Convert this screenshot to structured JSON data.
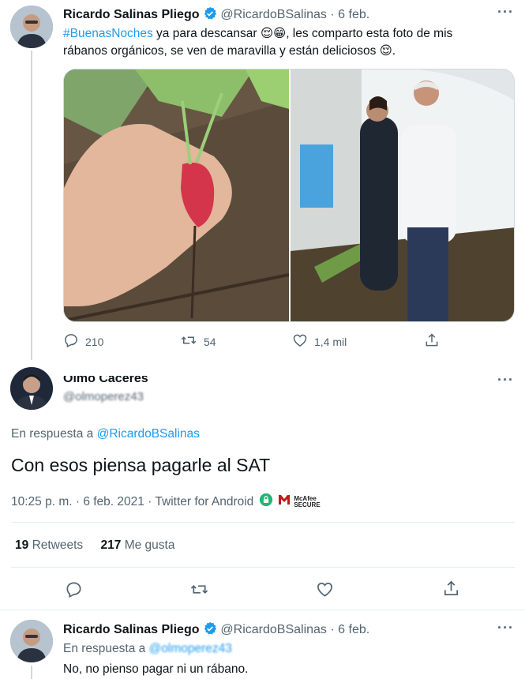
{
  "tweet1": {
    "name": "Ricardo Salinas Pliego",
    "handle": "@RicardoBSalinas",
    "date": "· 6 feb.",
    "hashtag": "#BuenasNoches",
    "text_part1": " ya para descansar 😌😁, les comparto esta foto de mis",
    "text_line2": "rábanos orgánicos, se ven de maravilla y están deliciosos 😌.",
    "replies": "210",
    "retweets": "54",
    "likes": "1,4 mil"
  },
  "tweet2": {
    "name": "Olmo Cáceres",
    "handle": "@olmoperez43",
    "reply_prefix": "En respuesta a ",
    "reply_to": "@RicardoBSalinas",
    "text": "Con esos piensa pagarle al SAT",
    "timestamp": "10:25 p. m. · 6 feb. 2021 · Twitter for Android",
    "mcafee_line1": "McAfee",
    "mcafee_line2": "SECURE",
    "retweets_count": "19",
    "retweets_label": "Retweets",
    "likes_count": "217",
    "likes_label": "Me gusta"
  },
  "tweet3": {
    "name": "Ricardo Salinas Pliego",
    "handle": "@RicardoBSalinas",
    "date": "· 6 feb.",
    "reply_prefix": "En respuesta a ",
    "reply_to": "@olmoperez43",
    "text": "No, no pienso pagar ni un rábano."
  },
  "colors": {
    "accent": "#1d9bf0",
    "text": "#0f1419",
    "muted": "#536471",
    "verified": "#1d9bf0",
    "mcafee": "#c01818"
  },
  "icons": [
    "verified-icon",
    "more-icon",
    "reply-icon",
    "retweet-icon",
    "like-icon",
    "share-icon",
    "lock-icon",
    "mcafee-icon"
  ]
}
